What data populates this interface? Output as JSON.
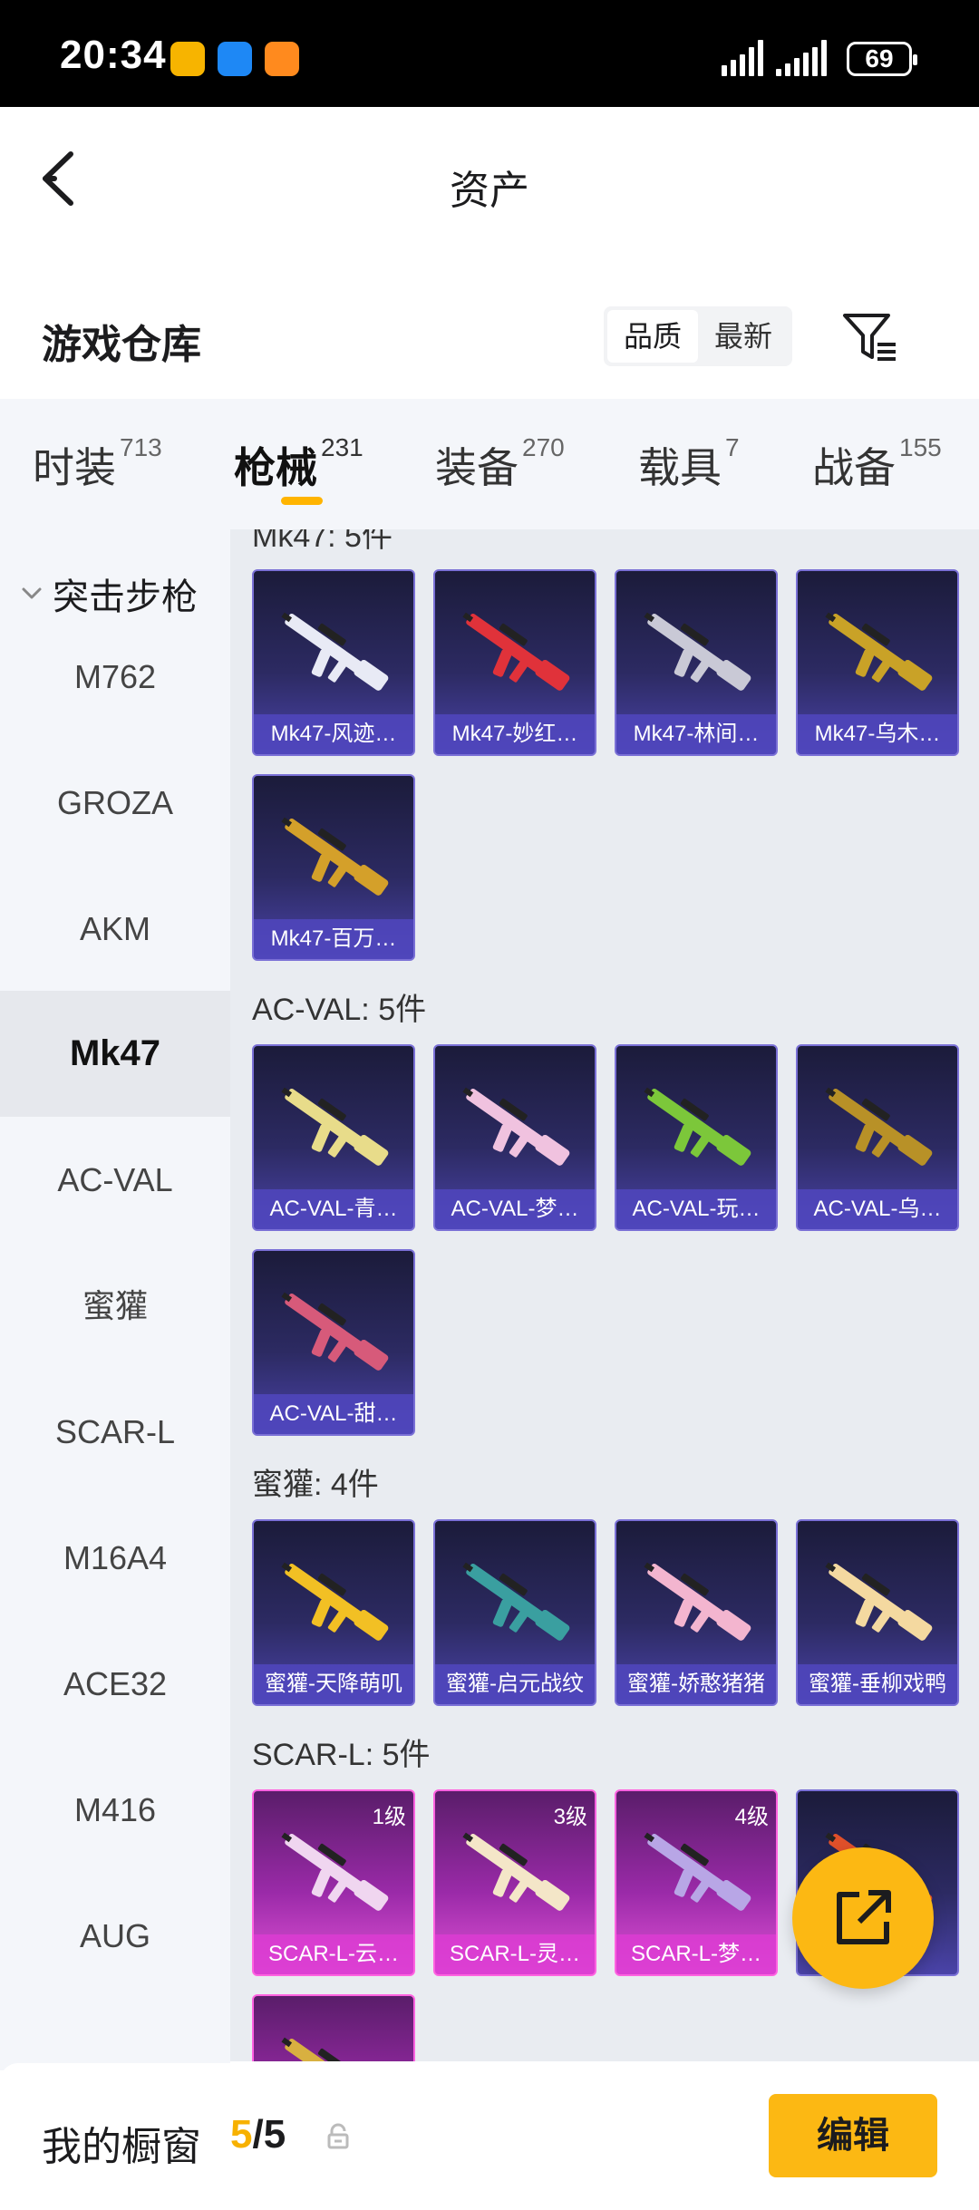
{
  "status_bar": {
    "time": "20:34",
    "battery": "69"
  },
  "nav": {
    "title": "资产"
  },
  "header": {
    "title": "游戏仓库",
    "sort_options": [
      "品质",
      "最新"
    ],
    "sort_selected": "品质"
  },
  "tabs": [
    {
      "label": "时装",
      "count": "713"
    },
    {
      "label": "枪械",
      "count": "231",
      "active": true
    },
    {
      "label": "装备",
      "count": "270"
    },
    {
      "label": "载具",
      "count": "7"
    },
    {
      "label": "战备",
      "count": "155"
    }
  ],
  "sidebar": {
    "group": "突击步枪",
    "items": [
      "M762",
      "GROZA",
      "AKM",
      "Mk47",
      "AC-VAL",
      "蜜獾",
      "SCAR-L",
      "M16A4",
      "ACE32",
      "M416",
      "AUG"
    ],
    "active": "Mk47"
  },
  "sections": [
    {
      "label": "Mk47: 5件",
      "items": [
        {
          "name": "Mk47-风迹…",
          "gun_color": "#e8eaf5"
        },
        {
          "name": "Mk47-妙红…",
          "gun_color": "#e0323a"
        },
        {
          "name": "Mk47-林间…",
          "gun_color": "#c9c9d6"
        },
        {
          "name": "Mk47-乌木…",
          "gun_color": "#c9a227"
        },
        {
          "name": "Mk47-百万…",
          "gun_color": "#d4a02a"
        }
      ]
    },
    {
      "label": "AC-VAL: 5件",
      "items": [
        {
          "name": "AC-VAL-青…",
          "gun_color": "#e8dc8a"
        },
        {
          "name": "AC-VAL-梦…",
          "gun_color": "#f0c2df"
        },
        {
          "name": "AC-VAL-玩…",
          "gun_color": "#7cc73a"
        },
        {
          "name": "AC-VAL-乌…",
          "gun_color": "#b89127"
        },
        {
          "name": "AC-VAL-甜…",
          "gun_color": "#d75a7a"
        }
      ]
    },
    {
      "label": "蜜獾: 4件",
      "items": [
        {
          "name": "蜜獾-天降萌叽",
          "gun_color": "#f2c024"
        },
        {
          "name": "蜜獾-启元战纹",
          "gun_color": "#3a9fa0"
        },
        {
          "name": "蜜獾-娇憨猪猪",
          "gun_color": "#f3b5cf"
        },
        {
          "name": "蜜獾-垂柳戏鸭",
          "gun_color": "#f4d9a0"
        }
      ]
    },
    {
      "label": "SCAR-L: 5件",
      "items": [
        {
          "name": "SCAR-L-云…",
          "level": "1级",
          "gun_color": "#f0d6f0"
        },
        {
          "name": "SCAR-L-灵…",
          "level": "3级",
          "gun_color": "#f4e6c8"
        },
        {
          "name": "SCAR-L-梦…",
          "level": "4级",
          "gun_color": "#b8a6e6"
        },
        {
          "name": "",
          "gun_color": "#e0502a"
        },
        {
          "name": "",
          "gun_color": "#d8b040"
        }
      ]
    }
  ],
  "bottom_bar": {
    "title": "我的橱窗",
    "count_current": "5",
    "count_total": "/5",
    "edit_label": "编辑"
  }
}
